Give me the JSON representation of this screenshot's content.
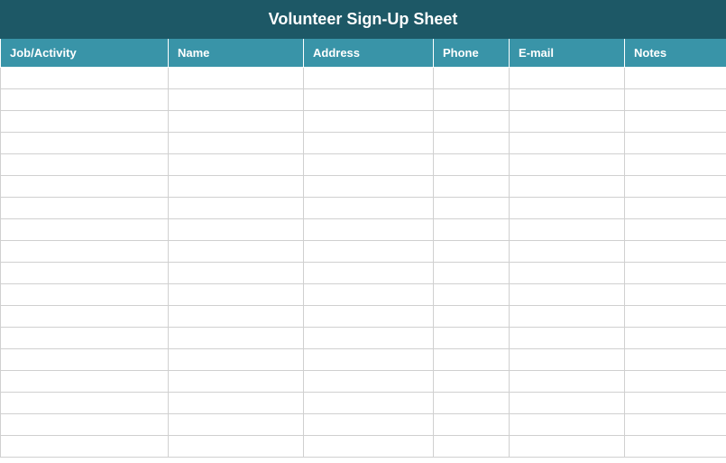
{
  "title": "Volunteer Sign-Up Sheet",
  "columns": [
    {
      "label": "Job/Activity"
    },
    {
      "label": "Name"
    },
    {
      "label": "Address"
    },
    {
      "label": "Phone"
    },
    {
      "label": "E-mail"
    },
    {
      "label": "Notes"
    }
  ],
  "rows": [
    {
      "job": "",
      "name": "",
      "address": "",
      "phone": "",
      "email": "",
      "notes": ""
    },
    {
      "job": "",
      "name": "",
      "address": "",
      "phone": "",
      "email": "",
      "notes": ""
    },
    {
      "job": "",
      "name": "",
      "address": "",
      "phone": "",
      "email": "",
      "notes": ""
    },
    {
      "job": "",
      "name": "",
      "address": "",
      "phone": "",
      "email": "",
      "notes": ""
    },
    {
      "job": "",
      "name": "",
      "address": "",
      "phone": "",
      "email": "",
      "notes": ""
    },
    {
      "job": "",
      "name": "",
      "address": "",
      "phone": "",
      "email": "",
      "notes": ""
    },
    {
      "job": "",
      "name": "",
      "address": "",
      "phone": "",
      "email": "",
      "notes": ""
    },
    {
      "job": "",
      "name": "",
      "address": "",
      "phone": "",
      "email": "",
      "notes": ""
    },
    {
      "job": "",
      "name": "",
      "address": "",
      "phone": "",
      "email": "",
      "notes": ""
    },
    {
      "job": "",
      "name": "",
      "address": "",
      "phone": "",
      "email": "",
      "notes": ""
    },
    {
      "job": "",
      "name": "",
      "address": "",
      "phone": "",
      "email": "",
      "notes": ""
    },
    {
      "job": "",
      "name": "",
      "address": "",
      "phone": "",
      "email": "",
      "notes": ""
    },
    {
      "job": "",
      "name": "",
      "address": "",
      "phone": "",
      "email": "",
      "notes": ""
    },
    {
      "job": "",
      "name": "",
      "address": "",
      "phone": "",
      "email": "",
      "notes": ""
    },
    {
      "job": "",
      "name": "",
      "address": "",
      "phone": "",
      "email": "",
      "notes": ""
    },
    {
      "job": "",
      "name": "",
      "address": "",
      "phone": "",
      "email": "",
      "notes": ""
    },
    {
      "job": "",
      "name": "",
      "address": "",
      "phone": "",
      "email": "",
      "notes": ""
    },
    {
      "job": "",
      "name": "",
      "address": "",
      "phone": "",
      "email": "",
      "notes": ""
    }
  ]
}
